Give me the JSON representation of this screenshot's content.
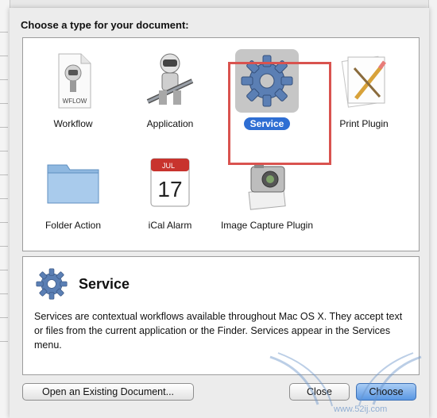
{
  "dialog": {
    "prompt": "Choose a type for your document:",
    "types": [
      {
        "label": "Workflow",
        "icon": "workflow-document-icon",
        "badge": "WFLOW"
      },
      {
        "label": "Application",
        "icon": "automator-robot-icon"
      },
      {
        "label": "Service",
        "icon": "gear-icon",
        "selected": true
      },
      {
        "label": "Print Plugin",
        "icon": "print-plugin-icon"
      },
      {
        "label": "Folder Action",
        "icon": "folder-icon"
      },
      {
        "label": "iCal Alarm",
        "icon": "calendar-icon",
        "month": "JUL",
        "day": "17"
      },
      {
        "label": "Image Capture Plugin",
        "icon": "camera-icon"
      }
    ],
    "description": {
      "title": "Service",
      "text": "Services are contextual workflows available throughout Mac OS X. They accept text or files from the current application or the Finder. Services appear in the Services menu."
    },
    "buttons": {
      "open": "Open an Existing Document...",
      "close": "Close",
      "choose": "Choose"
    }
  },
  "watermark": {
    "url": "www.52ij.com"
  },
  "colors": {
    "selection": "#2e6ed3",
    "highlight_box": "#d9534f",
    "default_button": "#5a97e3"
  }
}
